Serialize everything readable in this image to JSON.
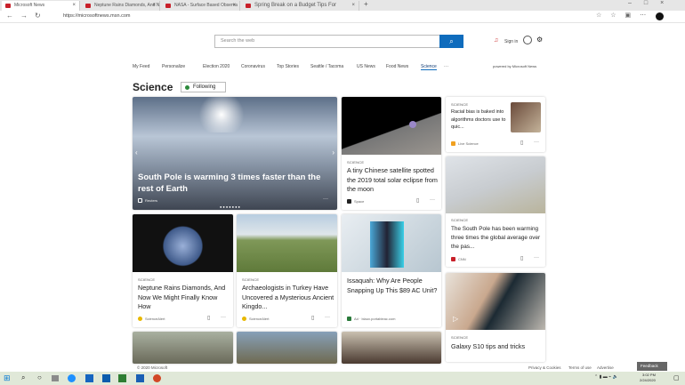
{
  "browser": {
    "tabs": [
      {
        "label": "Microsoft News",
        "active": true
      },
      {
        "label": "Neptune Rains Diamonds, And N"
      },
      {
        "label": "NASA - Surface Based Observa"
      },
      {
        "label": "Spring Break on a Budget Tips For"
      }
    ],
    "url": "https://microsoftnews.msn.com"
  },
  "header": {
    "search_placeholder": "Search the web",
    "user": "Sign in",
    "notification_count": "1"
  },
  "nav": {
    "items": [
      "My Feed",
      "Personalize",
      "Election 2020",
      "Coronavirus",
      "Top Stories",
      "Seattle / Tacoma",
      "US News",
      "Food News",
      "Science",
      "···"
    ],
    "active": "Science",
    "powered_by": "powered by Microsoft News"
  },
  "section": {
    "title": "Science",
    "follow_label": "Following"
  },
  "hero": {
    "headline": "South Pole is warming 3 times faster than the rest of Earth",
    "source": "Reuters"
  },
  "cards": [
    {
      "category": "SCIENCE",
      "headline": "A tiny Chinese satellite spotted the 2019 total solar eclipse from the moon",
      "source": "Space"
    },
    {
      "category": "SCIENCE",
      "headline": "Racial bias is baked into algorithms doctors use to quic...",
      "source": "Live Science"
    },
    {
      "category": "SCIENCE",
      "headline": "The South Pole has been warming three times the global average over the pas...",
      "source": "CNN"
    },
    {
      "category": "SCIENCE",
      "headline": "Neptune Rains Diamonds, And Now We Might Finally Know How",
      "source": "ScienceAlert"
    },
    {
      "category": "SCIENCE",
      "headline": "Archaeologists in Turkey Have Uncovered a Mysterious Ancient Kingdo...",
      "source": "ScienceAlert"
    },
    {
      "category": "",
      "headline": "Issaquah: Why Are People Snapping Up This $89 AC Unit?",
      "source": "Ad · blaux.portableac.com"
    },
    {
      "category": "SCIENCE",
      "headline": "Galaxy S10 tips and tricks",
      "source": ""
    }
  ],
  "footer": {
    "copyright": "© 2020 Microsoft",
    "links": [
      "Privacy & Cookies",
      "Terms of use",
      "Advertise"
    ],
    "feedback": "Feedback"
  },
  "taskbar": {
    "time": "3:02 PM",
    "date": "2/24/2020"
  }
}
